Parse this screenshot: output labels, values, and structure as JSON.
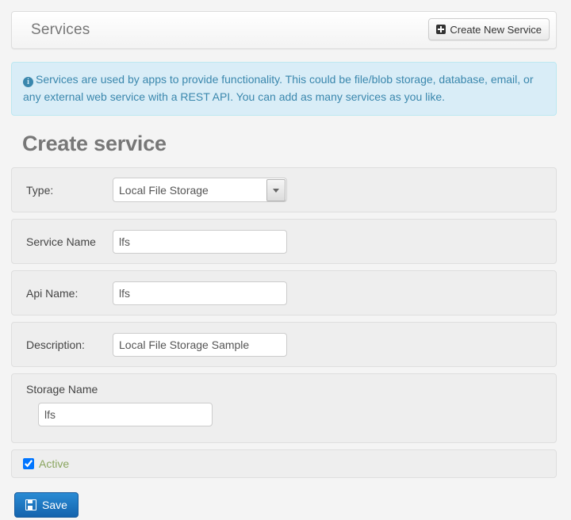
{
  "header": {
    "title": "Services",
    "create_button": {
      "label": "Create New Service",
      "icon": "plus-square-icon"
    }
  },
  "alert": {
    "icon": "info-circle-icon",
    "text": "Services are used by apps to provide functionality. This could be file/blob storage, database, email, or any external web service with a REST API. You can add as many services as you like."
  },
  "page_heading": "Create service",
  "form": {
    "type": {
      "label": "Type:",
      "value": "Local File Storage",
      "options": [
        "Local File Storage"
      ]
    },
    "service_name": {
      "label": "Service Name",
      "value": "lfs",
      "placeholder": ""
    },
    "api_name": {
      "label": "Api Name:",
      "value": "lfs",
      "placeholder": ""
    },
    "description": {
      "label": "Description:",
      "value": "Local File Storage Sample",
      "placeholder": ""
    },
    "storage_name": {
      "label": "Storage Name",
      "value": "lfs",
      "placeholder": ""
    },
    "active": {
      "label": "Active",
      "checked": true
    },
    "save_button": {
      "label": "Save",
      "icon": "save-floppy-icon"
    }
  },
  "colors": {
    "page_background": "#f4f4f4",
    "panel_background": "#eeeeee",
    "alert_background": "#d9edf7",
    "alert_border": "#bce8f1",
    "alert_text": "#3a87ad",
    "heading_text": "#777777",
    "active_label": "#8aa55f",
    "save_button": "#1f7ac4"
  }
}
